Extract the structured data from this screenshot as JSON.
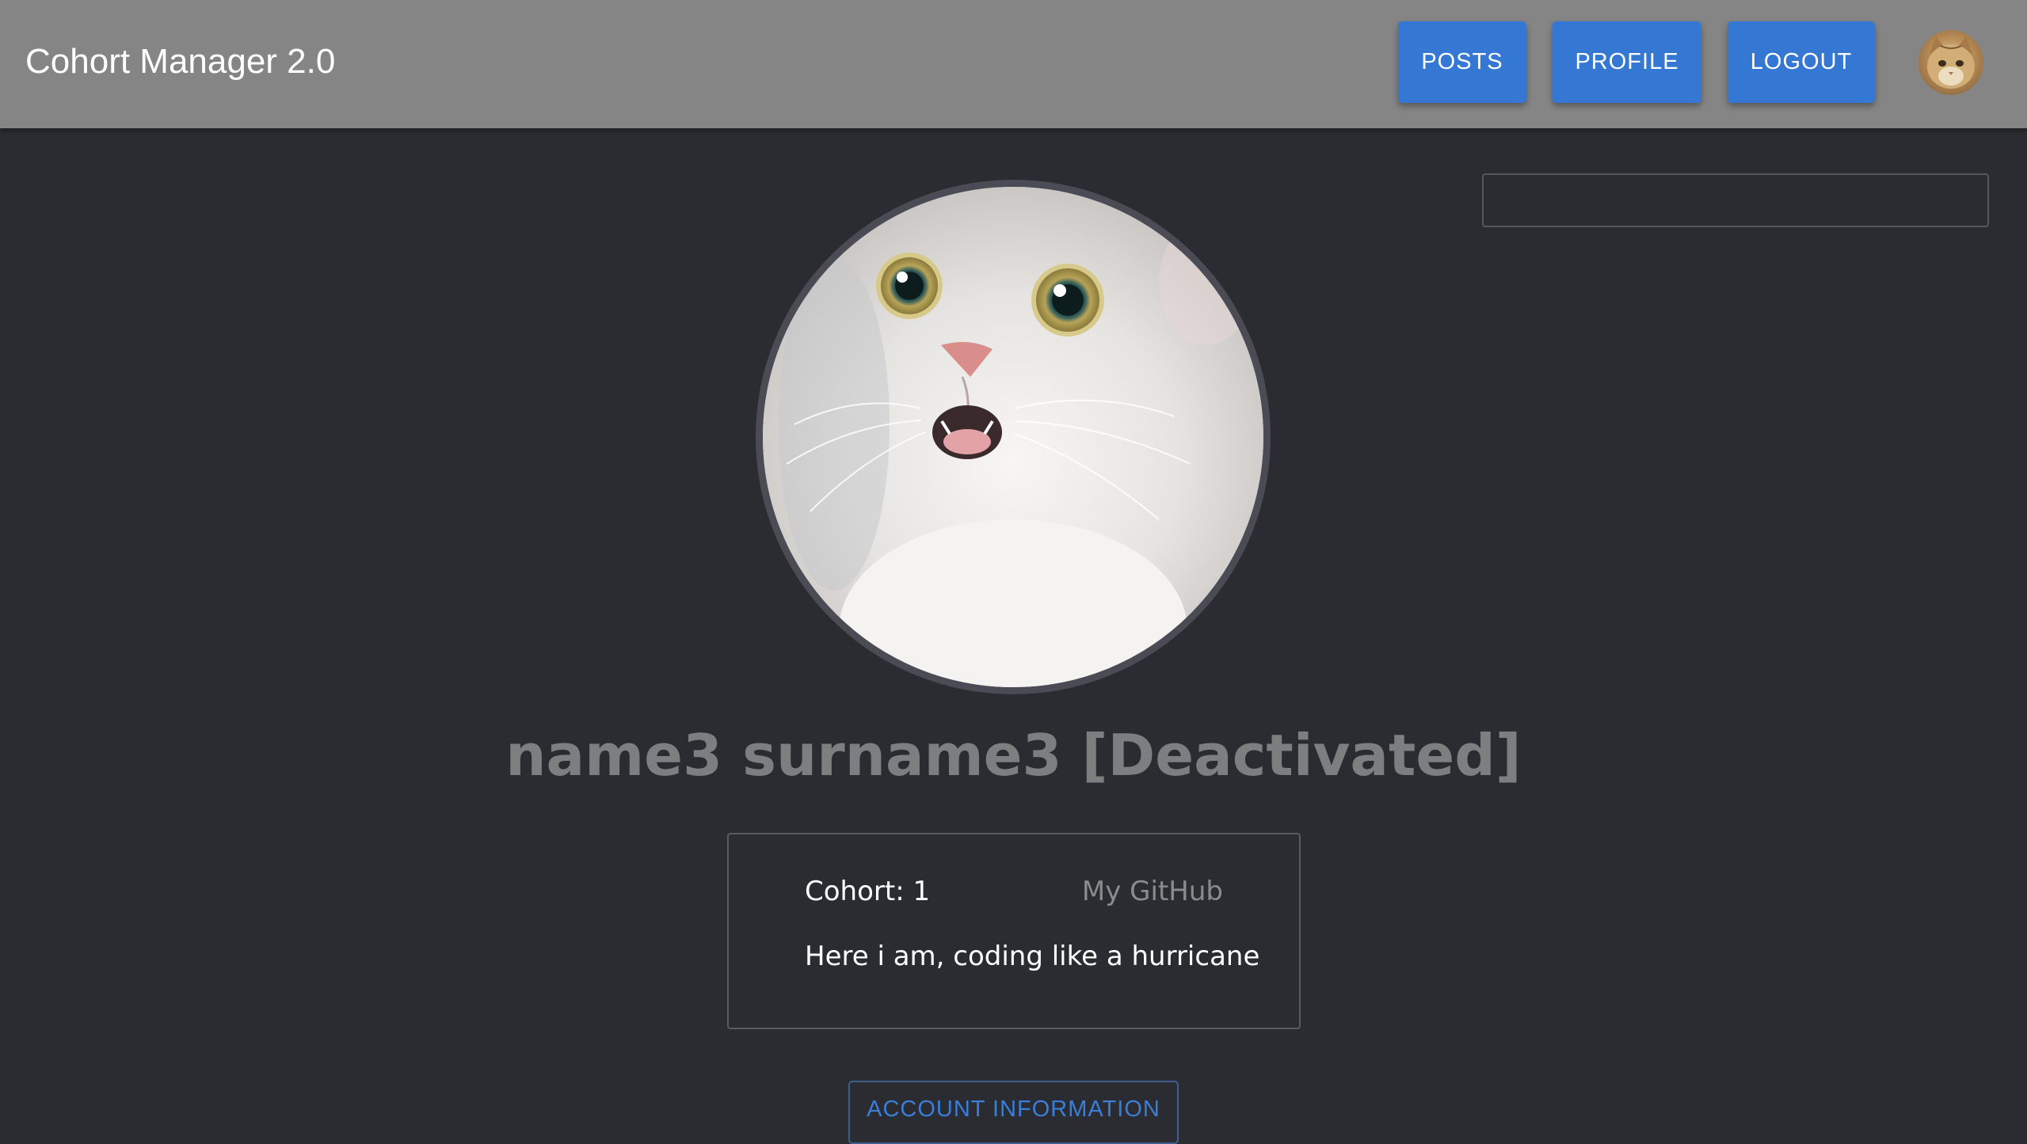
{
  "app": {
    "title": "Cohort Manager 2.0"
  },
  "nav": {
    "posts_label": "POSTS",
    "profile_label": "PROFILE",
    "logout_label": "LOGOUT",
    "avatar_icon": "cat-avatar-icon"
  },
  "search": {
    "value": "",
    "placeholder": ""
  },
  "profile": {
    "avatar_icon": "cat-photo",
    "name": "name3 surname3 [Deactivated]",
    "cohort": "Cohort: 1",
    "github_label": "My GitHub",
    "bio": "Here i am, coding like a hurricane",
    "account_button_label": "ACCOUNT INFORMATION"
  },
  "colors": {
    "appbar": "#858585",
    "background": "#2a2c31",
    "button_primary": "#3478d4",
    "outlined_button_text": "#3a7ed8",
    "name_text": "#7d7e80",
    "link_text": "#8a8b8e"
  }
}
